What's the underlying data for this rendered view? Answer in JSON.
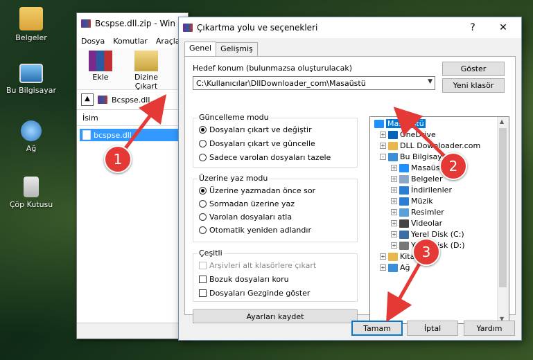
{
  "desktop": {
    "icons": [
      {
        "label": "Belgeler",
        "icon": "folder-user-icon"
      },
      {
        "label": "Bu Bilgisayar",
        "icon": "computer-icon"
      },
      {
        "label": "Ağ",
        "icon": "network-icon"
      },
      {
        "label": "Çöp Kutusu",
        "icon": "recycle-bin-icon"
      }
    ]
  },
  "bgwindow": {
    "title": "Bcspse.dll.zip - Win",
    "menu": [
      "Dosya",
      "Komutlar",
      "Araçla"
    ],
    "tools": [
      {
        "label": "Ekle"
      },
      {
        "label": "Dizine Çıkart"
      }
    ],
    "address": "Bcspse.dll.",
    "list_header": "İsim",
    "file": "bcspse.dll"
  },
  "dialog": {
    "title": "Çıkartma yolu ve seçenekleri",
    "help": "?",
    "close": "✕",
    "tabs": [
      "Genel",
      "Gelişmiş"
    ],
    "dest_label": "Hedef konum (bulunmazsa oluşturulacak)",
    "dest_value": "C:\\Kullanıcılar\\DllDownloader_com\\Masaüstü",
    "show_button": "Göster",
    "new_folder_button": "Yeni klasör",
    "update_group": {
      "title": "Güncelleme modu",
      "options": [
        "Dosyaları çıkart ve değiştir",
        "Dosyaları çıkart ve güncelle",
        "Sadece varolan dosyaları tazele"
      ],
      "selected": 0
    },
    "overwrite_group": {
      "title": "Üzerine yaz modu",
      "options": [
        "Üzerine yazmadan önce sor",
        "Sormadan üzerine yaz",
        "Varolan dosyaları atla",
        "Otomatik yeniden adlandır"
      ],
      "selected": 0
    },
    "misc_group": {
      "title": "Çeşitli",
      "options": [
        {
          "label": "Arşivleri alt klasörlere çıkart",
          "disabled": true,
          "checked": false
        },
        {
          "label": "Bozuk dosyaları koru",
          "disabled": false,
          "checked": false
        },
        {
          "label": "Dosyaları Gezginde göster",
          "disabled": false,
          "checked": false
        }
      ]
    },
    "save_settings_button": "Ayarları kaydet",
    "tree": [
      {
        "label": "Masaüstü",
        "level": 0,
        "selected": true,
        "icon": "desktop-icon",
        "color": "#1e90ff"
      },
      {
        "label": "OneDrive",
        "level": 1,
        "expand": "+",
        "icon": "onedrive-icon",
        "color": "#0364b8"
      },
      {
        "label": "DLL Downloader.com",
        "level": 1,
        "expand": "+",
        "icon": "user-folder-icon",
        "color": "#e8b84a"
      },
      {
        "label": "Bu Bilgisayar",
        "level": 1,
        "expand": "−",
        "icon": "computer-icon",
        "color": "#3a8fd6"
      },
      {
        "label": "Masaüstü",
        "level": 2,
        "expand": "+",
        "icon": "desktop-icon",
        "color": "#1e90ff"
      },
      {
        "label": "Belgeler",
        "level": 2,
        "expand": "+",
        "icon": "documents-icon",
        "color": "#8aa6c8"
      },
      {
        "label": "İndirilenler",
        "level": 2,
        "expand": "+",
        "icon": "downloads-icon",
        "color": "#2a7fd4"
      },
      {
        "label": "Müzik",
        "level": 2,
        "expand": "+",
        "icon": "music-icon",
        "color": "#2a7fd4"
      },
      {
        "label": "Resimler",
        "level": 2,
        "expand": "+",
        "icon": "pictures-icon",
        "color": "#5aa0d8"
      },
      {
        "label": "Videolar",
        "level": 2,
        "expand": "+",
        "icon": "videos-icon",
        "color": "#444"
      },
      {
        "label": "Yerel Disk (C:)",
        "level": 2,
        "expand": "+",
        "icon": "drive-icon",
        "color": "#3a6ea5"
      },
      {
        "label": "Yerel Disk (D:)",
        "level": 2,
        "expand": "+",
        "icon": "drive-icon",
        "color": "#777"
      },
      {
        "label": "Kitaplıklar",
        "level": 1,
        "expand": "+",
        "icon": "libraries-icon",
        "color": "#e8b84a"
      },
      {
        "label": "Ağ",
        "level": 1,
        "expand": "+",
        "icon": "network-icon",
        "color": "#3a8fd6"
      }
    ],
    "ok_button": "Tamam",
    "cancel_button": "İptal",
    "help_button": "Yardım"
  },
  "annotations": [
    "1",
    "2",
    "3"
  ],
  "colors": {
    "accent": "#0078d7",
    "selection": "#3399ff",
    "annotation": "#e53935"
  }
}
